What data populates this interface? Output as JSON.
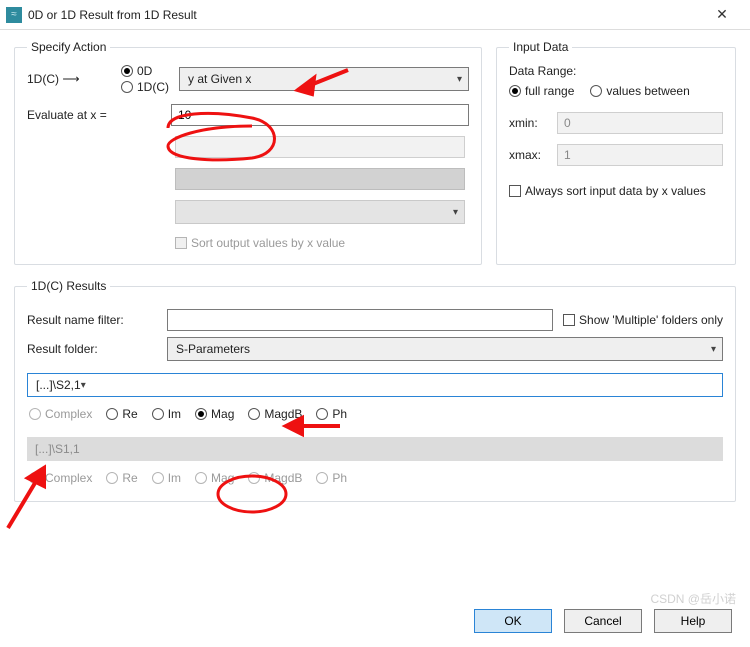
{
  "window": {
    "title": "0D or 1D Result from 1D Result",
    "icon_glyph": "≈",
    "close_glyph": "✕"
  },
  "specify_action": {
    "legend": "Specify Action",
    "chain_label": "1D(C) ⟶",
    "mode_options": {
      "zero_d": "0D",
      "one_dc": "1D(C)"
    },
    "mode_selected": "0D",
    "main_select_value": "y at Given x",
    "evaluate_label": "Evaluate at x =",
    "evaluate_value": "10",
    "sub_input_value": "",
    "sub_input2_value": "",
    "sub_select_value": "",
    "sort_label": "Sort output values by x value",
    "sort_checked": false,
    "sort_enabled": false
  },
  "input_data": {
    "legend": "Input Data",
    "range_label": "Data Range:",
    "range_options": {
      "full": "full range",
      "between": "values between"
    },
    "range_selected": "full",
    "xmin_label": "xmin:",
    "xmin_value": "0",
    "xmax_label": "xmax:",
    "xmax_value": "1",
    "always_sort_label": "Always sort input data by x values",
    "always_sort_checked": false
  },
  "results": {
    "legend": "1D(C) Results",
    "filter_label": "Result name filter:",
    "filter_value": "",
    "show_multiple_label": "Show 'Multiple' folders only",
    "show_multiple_checked": false,
    "folder_label": "Result folder:",
    "folder_value": "S-Parameters",
    "selection1": {
      "path": "[...]\\S2,1",
      "format_options": [
        "Complex",
        "Re",
        "Im",
        "Mag",
        "MagdB",
        "Ph"
      ],
      "format_selected": "Mag",
      "enabled": true
    },
    "selection2": {
      "path": "[...]\\S1,1",
      "format_options": [
        "Complex",
        "Re",
        "Im",
        "Mag",
        "MagdB",
        "Ph"
      ],
      "format_selected": "",
      "enabled": false
    }
  },
  "buttons": {
    "ok": "OK",
    "cancel": "Cancel",
    "help": "Help"
  },
  "watermark": "CSDN @岳小诺"
}
